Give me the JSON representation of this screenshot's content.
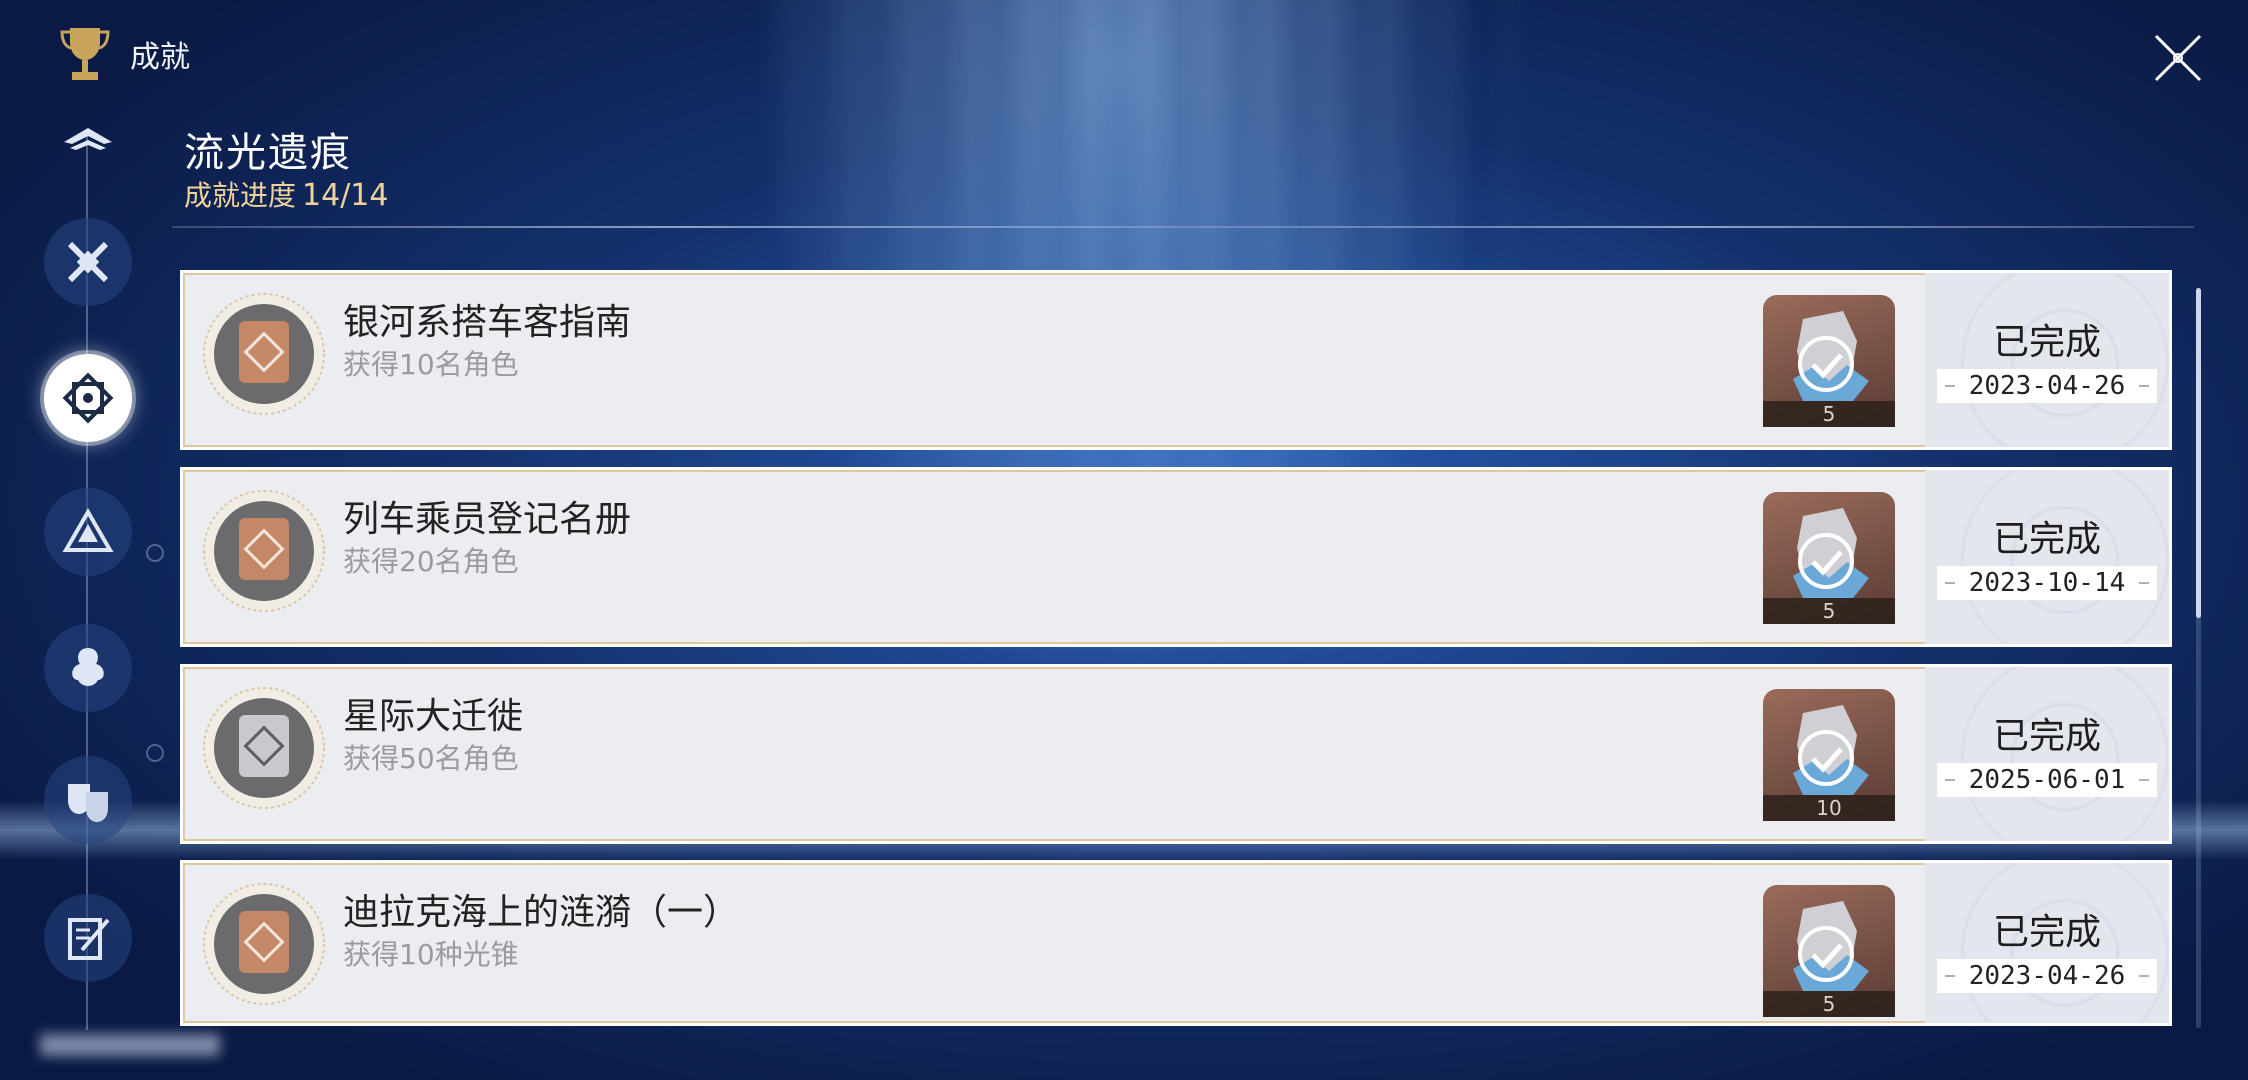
{
  "header": {
    "title": "成就"
  },
  "category": {
    "title": "流光遗痕",
    "progress_label": "成就进度",
    "progress_value": "14/14"
  },
  "achievements": [
    {
      "name": "银河系搭车客指南",
      "desc": "获得10名角色",
      "reward_qty": "5",
      "status": "已完成",
      "date": "2023-04-26",
      "medal": "bronze"
    },
    {
      "name": "列车乘员登记名册",
      "desc": "获得20名角色",
      "reward_qty": "5",
      "status": "已完成",
      "date": "2023-10-14",
      "medal": "bronze"
    },
    {
      "name": "星际大迁徙",
      "desc": "获得50名角色",
      "reward_qty": "10",
      "status": "已完成",
      "date": "2025-06-01",
      "medal": "silver"
    },
    {
      "name": "迪拉克海上的涟漪（一）",
      "desc": "获得10种光锥",
      "reward_qty": "5",
      "status": "已完成",
      "date": "2023-04-26",
      "medal": "bronze"
    }
  ],
  "colors": {
    "progress": "#f0d39a",
    "card_bg": "#ecedf1",
    "card_border": "#e0c79e"
  },
  "sidebar": {
    "items": [
      {
        "icon": "wings-emblem-icon"
      },
      {
        "icon": "crossed-swords-icon"
      },
      {
        "icon": "diamond-emblem-icon",
        "active": true
      },
      {
        "icon": "triangle-knot-icon"
      },
      {
        "icon": "tentacle-emblem-icon"
      },
      {
        "icon": "theater-masks-icon"
      },
      {
        "icon": "quill-notebook-icon"
      }
    ]
  }
}
